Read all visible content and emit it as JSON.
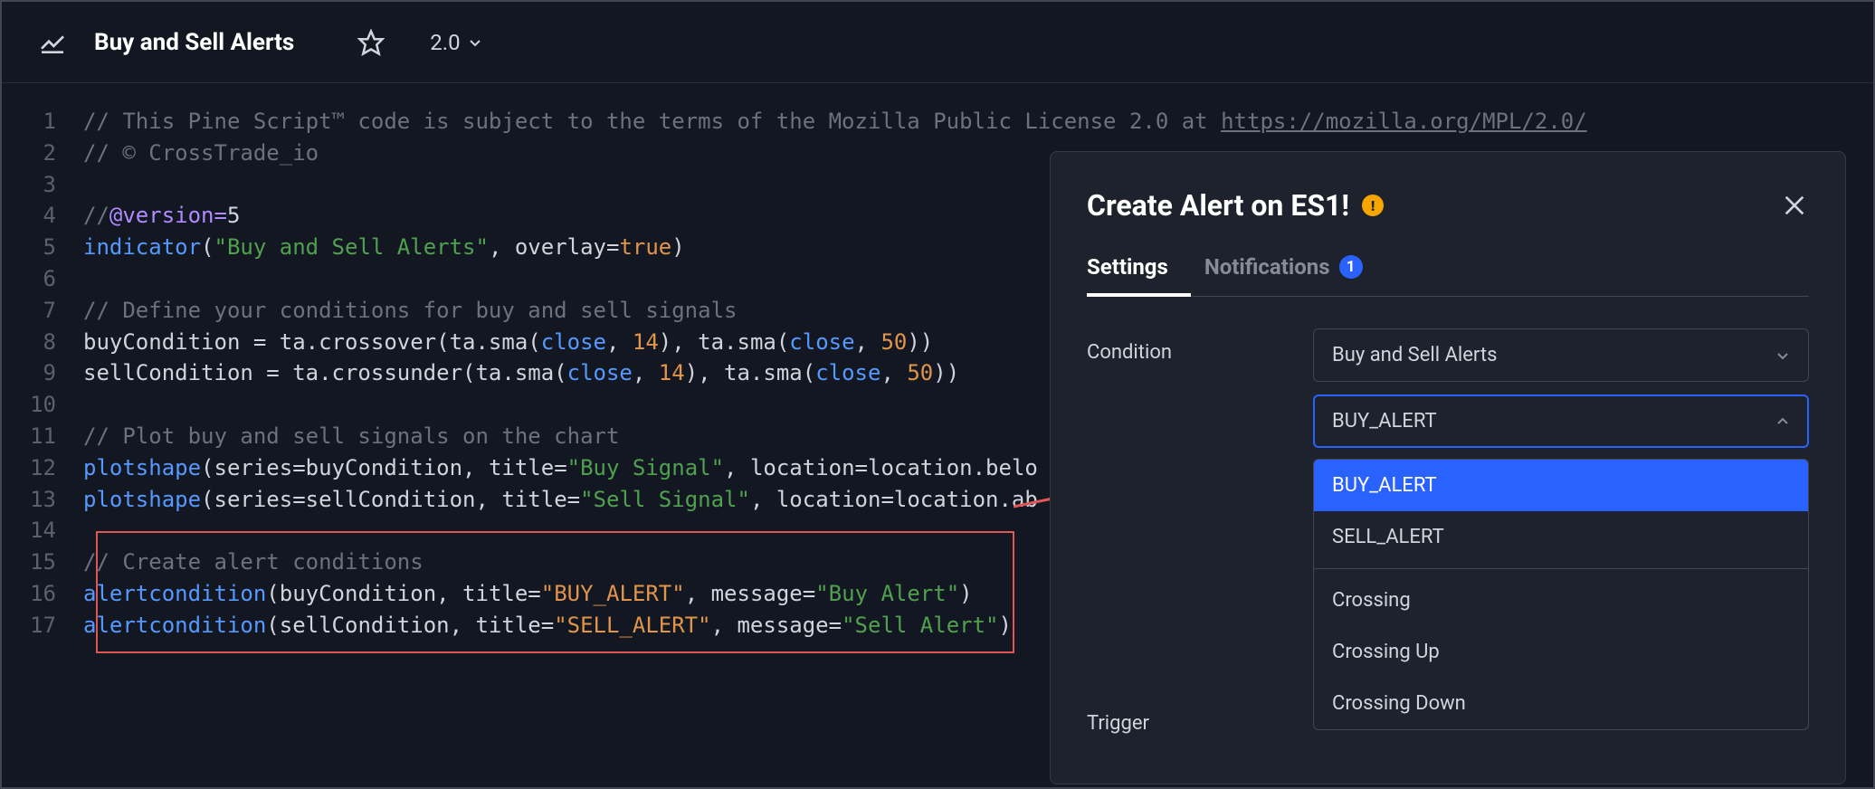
{
  "header": {
    "title": "Buy and Sell Alerts",
    "version": "2.0"
  },
  "code": {
    "lines": [
      {
        "n": 1,
        "segments": [
          {
            "c": "c-comment",
            "t": "// This Pine Script™ code is subject to the terms of the Mozilla Public License 2.0 at "
          },
          {
            "c": "c-link",
            "t": "https://mozilla.org/MPL/2.0/"
          }
        ]
      },
      {
        "n": 2,
        "segments": [
          {
            "c": "c-comment",
            "t": "// © CrossTrade_io"
          }
        ]
      },
      {
        "n": 3,
        "segments": []
      },
      {
        "n": 4,
        "segments": [
          {
            "c": "c-comment",
            "t": "//"
          },
          {
            "c": "c-version",
            "t": "@version="
          },
          {
            "c": "c-versionnum",
            "t": "5"
          }
        ]
      },
      {
        "n": 5,
        "segments": [
          {
            "c": "c-func",
            "t": "indicator"
          },
          {
            "c": "c-default",
            "t": "("
          },
          {
            "c": "c-string",
            "t": "\"Buy and Sell Alerts\""
          },
          {
            "c": "c-default",
            "t": ", "
          },
          {
            "c": "c-param",
            "t": "overlay"
          },
          {
            "c": "c-default",
            "t": "="
          },
          {
            "c": "c-bool",
            "t": "true"
          },
          {
            "c": "c-default",
            "t": ")"
          }
        ]
      },
      {
        "n": 6,
        "segments": []
      },
      {
        "n": 7,
        "segments": [
          {
            "c": "c-comment",
            "t": "// Define your conditions for buy and sell signals"
          }
        ]
      },
      {
        "n": 8,
        "segments": [
          {
            "c": "c-default",
            "t": "buyCondition = ta.crossover(ta.sma("
          },
          {
            "c": "c-func",
            "t": "close"
          },
          {
            "c": "c-default",
            "t": ", "
          },
          {
            "c": "c-num",
            "t": "14"
          },
          {
            "c": "c-default",
            "t": "), ta.sma("
          },
          {
            "c": "c-func",
            "t": "close"
          },
          {
            "c": "c-default",
            "t": ", "
          },
          {
            "c": "c-num",
            "t": "50"
          },
          {
            "c": "c-default",
            "t": "))"
          }
        ]
      },
      {
        "n": 9,
        "segments": [
          {
            "c": "c-default",
            "t": "sellCondition = ta.crossunder(ta.sma("
          },
          {
            "c": "c-func",
            "t": "close"
          },
          {
            "c": "c-default",
            "t": ", "
          },
          {
            "c": "c-num",
            "t": "14"
          },
          {
            "c": "c-default",
            "t": "), ta.sma("
          },
          {
            "c": "c-func",
            "t": "close"
          },
          {
            "c": "c-default",
            "t": ", "
          },
          {
            "c": "c-num",
            "t": "50"
          },
          {
            "c": "c-default",
            "t": "))"
          }
        ]
      },
      {
        "n": 10,
        "segments": []
      },
      {
        "n": 11,
        "segments": [
          {
            "c": "c-comment",
            "t": "// Plot buy and sell signals on the chart"
          }
        ]
      },
      {
        "n": 12,
        "segments": [
          {
            "c": "c-func",
            "t": "plotshape"
          },
          {
            "c": "c-default",
            "t": "("
          },
          {
            "c": "c-param",
            "t": "series"
          },
          {
            "c": "c-default",
            "t": "=buyCondition, "
          },
          {
            "c": "c-param",
            "t": "title"
          },
          {
            "c": "c-default",
            "t": "="
          },
          {
            "c": "c-string",
            "t": "\"Buy Signal\""
          },
          {
            "c": "c-default",
            "t": ", "
          },
          {
            "c": "c-param",
            "t": "location"
          },
          {
            "c": "c-default",
            "t": "=location.belo"
          }
        ]
      },
      {
        "n": 13,
        "segments": [
          {
            "c": "c-func",
            "t": "plotshape"
          },
          {
            "c": "c-default",
            "t": "("
          },
          {
            "c": "c-param",
            "t": "series"
          },
          {
            "c": "c-default",
            "t": "=sellCondition, "
          },
          {
            "c": "c-param",
            "t": "title"
          },
          {
            "c": "c-default",
            "t": "="
          },
          {
            "c": "c-string",
            "t": "\"Sell Signal\""
          },
          {
            "c": "c-default",
            "t": ", "
          },
          {
            "c": "c-param",
            "t": "location"
          },
          {
            "c": "c-default",
            "t": "=location.ab"
          }
        ]
      },
      {
        "n": 14,
        "segments": []
      },
      {
        "n": 15,
        "segments": [
          {
            "c": "c-comment",
            "t": "// Create alert conditions"
          }
        ]
      },
      {
        "n": 16,
        "segments": [
          {
            "c": "c-func",
            "t": "alertcondition"
          },
          {
            "c": "c-default",
            "t": "(buyCondition, "
          },
          {
            "c": "c-param",
            "t": "title"
          },
          {
            "c": "c-default",
            "t": "="
          },
          {
            "c": "c-alert",
            "t": "\"BUY_ALERT\""
          },
          {
            "c": "c-default",
            "t": ", "
          },
          {
            "c": "c-param",
            "t": "message"
          },
          {
            "c": "c-default",
            "t": "="
          },
          {
            "c": "c-string",
            "t": "\"Buy Alert\""
          },
          {
            "c": "c-default",
            "t": ")"
          }
        ]
      },
      {
        "n": 17,
        "segments": [
          {
            "c": "c-func",
            "t": "alertcondition"
          },
          {
            "c": "c-default",
            "t": "(sellCondition, "
          },
          {
            "c": "c-param",
            "t": "title"
          },
          {
            "c": "c-default",
            "t": "="
          },
          {
            "c": "c-alert",
            "t": "\"SELL_ALERT\""
          },
          {
            "c": "c-default",
            "t": ", "
          },
          {
            "c": "c-param",
            "t": "message"
          },
          {
            "c": "c-default",
            "t": "="
          },
          {
            "c": "c-string",
            "t": "\"Sell Alert\""
          },
          {
            "c": "c-default",
            "t": ")"
          }
        ]
      }
    ]
  },
  "panel": {
    "title": "Create Alert on ES1!",
    "tabs": {
      "settings": "Settings",
      "notifications": "Notifications",
      "notif_count": "1"
    },
    "condition_label": "Condition",
    "trigger_label": "Trigger",
    "select_source": "Buy and Sell Alerts",
    "select_alert": "BUY_ALERT",
    "dropdown": {
      "buy": "BUY_ALERT",
      "sell": "SELL_ALERT",
      "crossing": "Crossing",
      "crossing_up": "Crossing Up",
      "crossing_down": "Crossing Down"
    }
  }
}
